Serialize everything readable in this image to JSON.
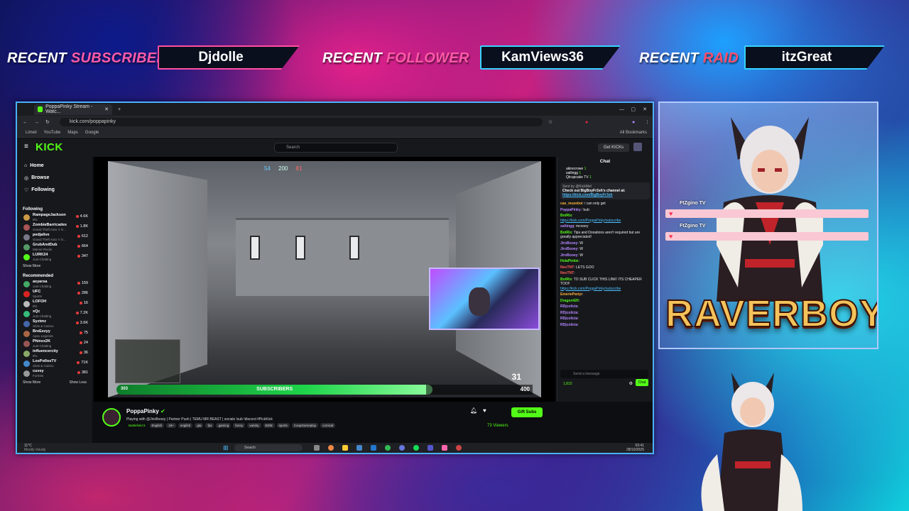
{
  "overlay": {
    "subscriber": {
      "label_a": "RECENT",
      "label_b": "SUBSCRIBER",
      "name": "Djdolle"
    },
    "follower": {
      "label_a": "RECENT",
      "label_b": "FOLLOWER",
      "name": "KamViews36"
    },
    "raid": {
      "label_a": "RECENT",
      "label_b": "RAID",
      "name": "itzGreat"
    },
    "brand": "RAVERBOYZ",
    "notif1": "FtZgino TV",
    "notif2": "FtZgino TV",
    "accent": "#ff4fa0"
  },
  "browser": {
    "tab_title": "PoppaPinky Stream - Watc...",
    "url": "kick.com/poppapinky",
    "bookmarks": [
      "Limeil",
      "YouTube",
      "Maps",
      "Google"
    ],
    "all_bookmarks": "All Bookmarks"
  },
  "kick": {
    "logo": "KICK",
    "search_placeholder": "Search",
    "get_kicks": "Get KICKs",
    "nav": [
      {
        "label": "Home",
        "icon": "home-icon"
      },
      {
        "label": "Browse",
        "icon": "compass-icon"
      },
      {
        "label": "Following",
        "icon": "heart-icon"
      }
    ],
    "following_header": "Following",
    "following": [
      {
        "name": "RampageJackson",
        "sub": "IRL",
        "count": "4.6K",
        "color": "#c94"
      },
      {
        "name": "ZombieBarricades",
        "sub": "Grand Theft Auto V G...",
        "count": "1.8K",
        "color": "#a55"
      },
      {
        "name": "pedjalive",
        "sub": "Grand Theft Auto V G...",
        "count": "612",
        "color": "#778"
      },
      {
        "name": "GrubAndDub",
        "sub": "Marvel Rivals",
        "count": "664",
        "color": "#596"
      },
      {
        "name": "LURK24",
        "sub": "Just Chatting",
        "count": "347",
        "color": "#53fc18"
      }
    ],
    "show_more": "Show More",
    "recommended_header": "Recommended",
    "recommended": [
      {
        "name": "asyarsa",
        "sub": "Just Chatting",
        "count": "159",
        "color": "#4a6"
      },
      {
        "name": "UFC",
        "sub": "Sports",
        "count": "286",
        "color": "#d22"
      },
      {
        "name": "LOFOH",
        "sub": "IRL",
        "count": "16",
        "color": "#bbb"
      },
      {
        "name": "xQc",
        "sub": "Just Chatting",
        "count": "7.2K",
        "color": "#3b7"
      },
      {
        "name": "Syztmz",
        "sub": "Slots & Casino",
        "count": "3.6K",
        "color": "#46a"
      },
      {
        "name": "BreEezyy",
        "sub": "Apex Legends",
        "count": "75",
        "color": "#a64"
      },
      {
        "name": "Phinxx2K",
        "sub": "Just Chatting",
        "count": "24",
        "color": "#955"
      },
      {
        "name": "influencercity",
        "sub": "IRL",
        "count": "36",
        "color": "#8a6"
      },
      {
        "name": "LosPollosTV",
        "sub": "Slots & Casino",
        "count": "71K",
        "color": "#48c"
      },
      {
        "name": "cuvey",
        "sub": "Fortnite",
        "count": "381",
        "color": "#999"
      }
    ],
    "show_more_2": "Show More",
    "show_less": "Show Less",
    "weather_temp": "11°C",
    "weather_desc": "Mostly cloudy"
  },
  "stream": {
    "hud_score_left": "54",
    "hud_score_mid": "200",
    "hud_score_right": "81",
    "sub_count": "303",
    "sub_label": "SUBSCRIBERS",
    "sub_target": "400",
    "sub_progress": 0.7,
    "ammo": "31",
    "streamer": "PoppaPinky",
    "title_prefix": "Playing with",
    "title_rest": "@JiroBooey | Partner Push | TEMU MR BEAST | socials !sub !discord #PickKick",
    "game": "Battlefield 6",
    "tags": [
      "English",
      "18+",
      "english",
      "gta",
      "fps",
      "gaming",
      "funny",
      "variety",
      "EDM",
      "sports",
      "CoopGameplay",
      "comical"
    ],
    "gift_subs": "Gift Subs",
    "viewers": "73 Viewers"
  },
  "chat": {
    "title": "Chat",
    "top_gifters": [
      {
        "name": "akirecrowe",
        "count": "1"
      },
      {
        "name": "sailingg",
        "count": "1"
      },
      {
        "name": "Qtcupcake TV",
        "count": "1"
      }
    ],
    "pinned_by": "Sent by @KickMel",
    "pinned_text": "Check out BigBoyFr3sh's channel at:",
    "pinned_link": "https://kick.com/BigBoyFr3sh",
    "messages": [
      {
        "user": "cas_muzeboi",
        "cls": "o",
        "text": "i can only get"
      },
      {
        "user": "PoppaPinky",
        "cls": "",
        "text": "!sub"
      },
      {
        "user": "BotRix",
        "cls": "g",
        "text": "",
        "link": "https://kick.com/PoppaPinky/subscribe"
      },
      {
        "user": "saltingg",
        "cls": "",
        "text": "mcooey"
      },
      {
        "user": "BotRix",
        "cls": "g",
        "text": "Tips and Donations aren't required but are greatly appreciated!"
      },
      {
        "user": "JiroBooey",
        "cls": "",
        "text": "W"
      },
      {
        "user": "JiroBooey",
        "cls": "",
        "text": "W"
      },
      {
        "user": "JiroBooey",
        "cls": "",
        "text": "W"
      },
      {
        "user": "HolaPinkie",
        "cls": "g",
        "text": ""
      },
      {
        "user": "NeoTNT",
        "cls": "r",
        "text": "LETS GOO"
      },
      {
        "user": "NeoTNT",
        "cls": "r",
        "text": ""
      },
      {
        "user": "BotRix",
        "cls": "g",
        "text": "TO SUB CLICK THIS LINK! ITS CHEAPER TOO!!",
        "link": "https://kick.com/PoppaPinky/subscribe"
      },
      {
        "user": "EmeriePartyr",
        "cls": "o",
        "text": ""
      },
      {
        "user": "Dragon420",
        "cls": "g",
        "text": ""
      },
      {
        "user": "RDjcolicia",
        "cls": "",
        "text": ""
      },
      {
        "user": "RDjcolicia",
        "cls": "",
        "text": ""
      },
      {
        "user": "RDjcolicia",
        "cls": "",
        "text": ""
      },
      {
        "user": "RDjcolicia",
        "cls": "",
        "text": ""
      }
    ],
    "points": "1,815",
    "input_placeholder": "Send a message",
    "send": "Chat"
  },
  "taskbar": {
    "search": "Search",
    "time": "03:41",
    "date": "28/10/2025"
  }
}
